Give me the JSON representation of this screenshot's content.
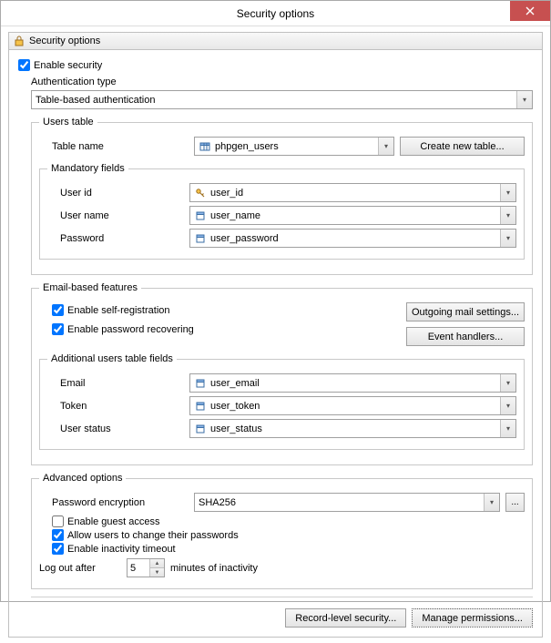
{
  "window": {
    "title": "Security options"
  },
  "header": {
    "title": "Security options"
  },
  "enable_security": {
    "label": "Enable security",
    "checked": true
  },
  "auth_type": {
    "label": "Authentication type",
    "value": "Table-based authentication"
  },
  "users_table": {
    "legend": "Users table",
    "table_name_label": "Table name",
    "table_name_value": "phpgen_users",
    "create_btn": "Create new table..."
  },
  "mandatory": {
    "legend": "Mandatory fields",
    "user_id_label": "User id",
    "user_id_value": "user_id",
    "user_name_label": "User name",
    "user_name_value": "user_name",
    "password_label": "Password",
    "password_value": "user_password"
  },
  "email_features": {
    "legend": "Email-based features",
    "self_reg_label": "Enable self-registration",
    "self_reg_checked": true,
    "pwd_recover_label": "Enable password recovering",
    "pwd_recover_checked": true,
    "outgoing_btn": "Outgoing mail settings...",
    "handlers_btn": "Event handlers..."
  },
  "additional": {
    "legend": "Additional users table fields",
    "email_label": "Email",
    "email_value": "user_email",
    "token_label": "Token",
    "token_value": "user_token",
    "status_label": "User status",
    "status_value": "user_status"
  },
  "advanced": {
    "legend": "Advanced options",
    "encryption_label": "Password encryption",
    "encryption_value": "SHA256",
    "guest_label": "Enable guest access",
    "guest_checked": false,
    "change_pwd_label": "Allow users to change their passwords",
    "change_pwd_checked": true,
    "inactivity_label": "Enable inactivity timeout",
    "inactivity_checked": true,
    "logout_label": "Log out after",
    "logout_value": "5",
    "logout_suffix": "minutes of inactivity"
  },
  "footer": {
    "record_level": "Record-level security...",
    "manage_perms": "Manage permissions..."
  }
}
